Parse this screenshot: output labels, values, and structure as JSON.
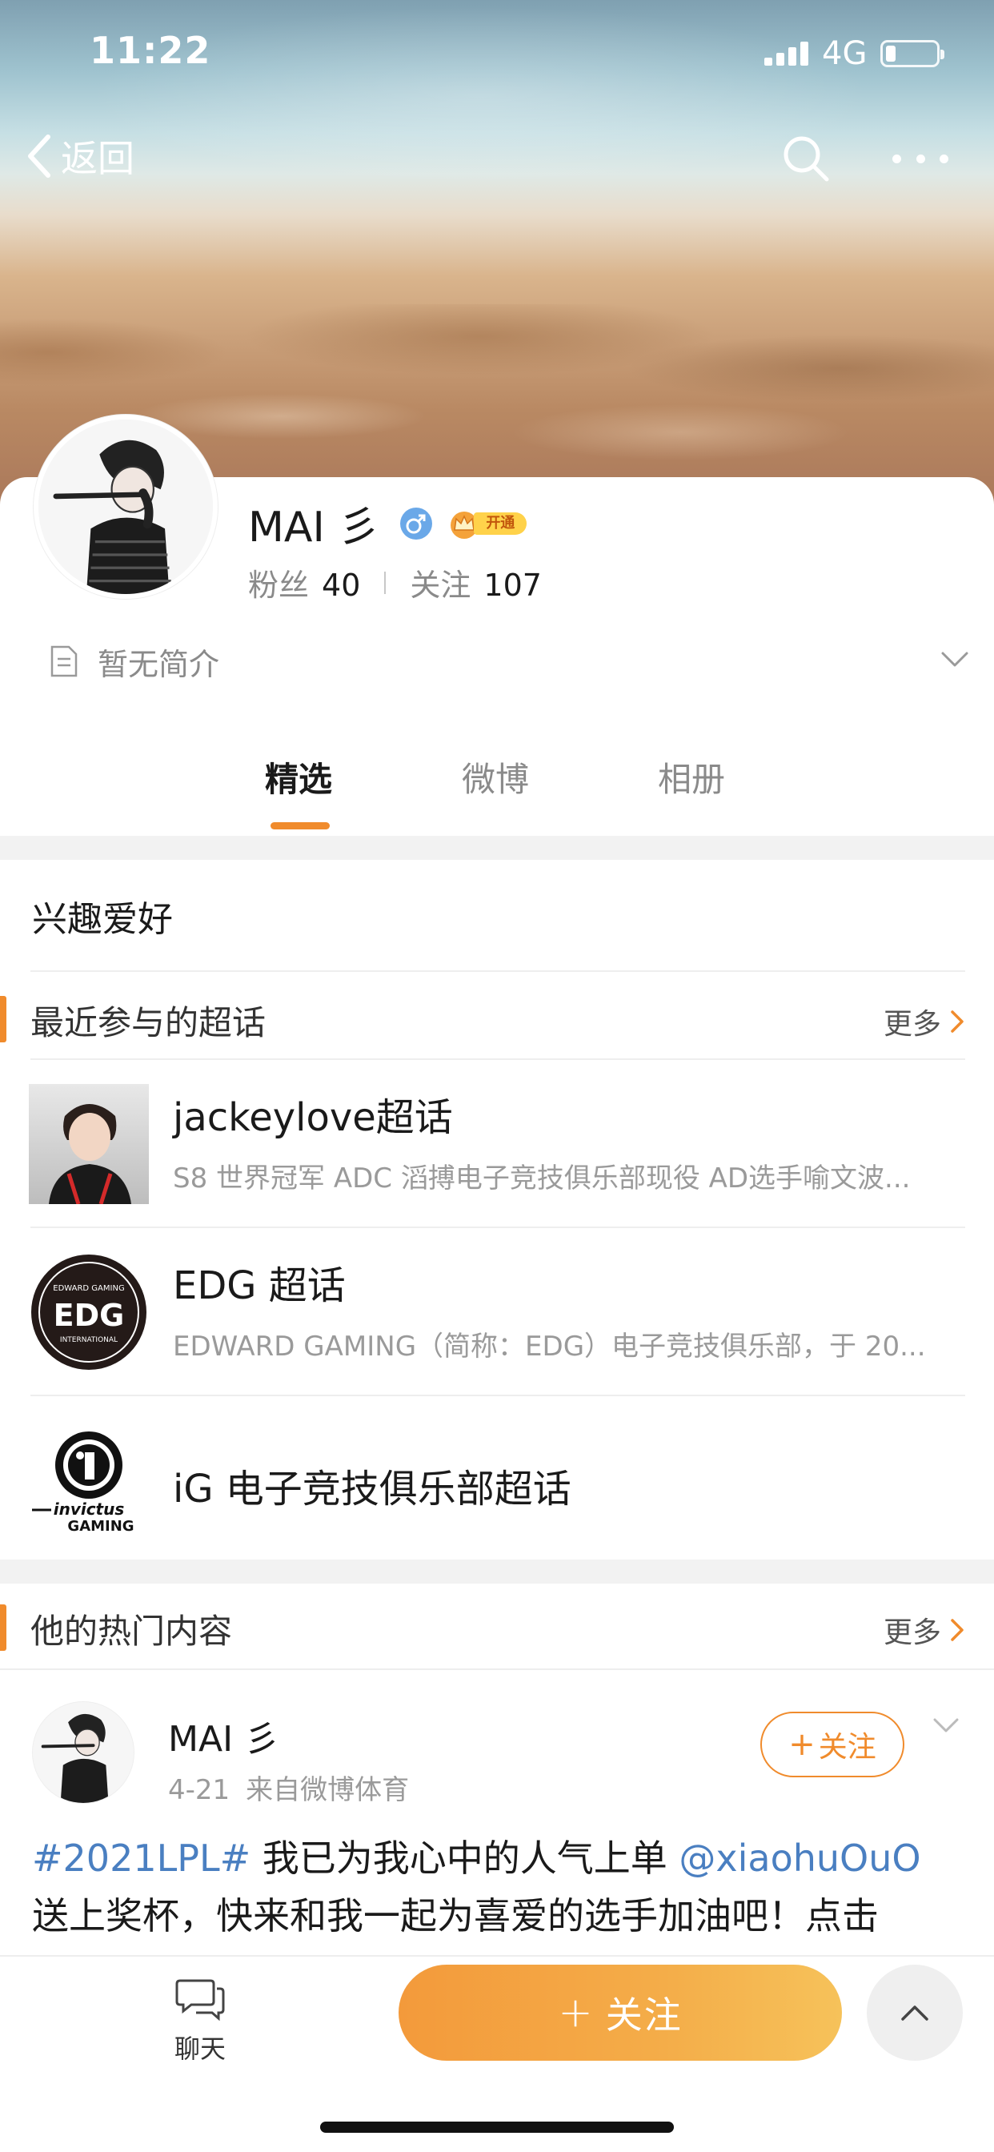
{
  "status_bar": {
    "time": "11:22",
    "network": "4G"
  },
  "nav": {
    "back_label": "返回"
  },
  "profile": {
    "name": "MAI 彡",
    "vip_label": "开通",
    "fans_label": "粉丝",
    "fans_count": "40",
    "following_label": "关注",
    "following_count": "107",
    "intro": "暂无简介"
  },
  "tabs": [
    {
      "label": "精选",
      "active": true
    },
    {
      "label": "微博",
      "active": false
    },
    {
      "label": "相册",
      "active": false
    }
  ],
  "interests": {
    "title": "兴趣爱好",
    "topics_header": "最近参与的超话",
    "more_label": "更多",
    "topics": [
      {
        "title": "jackeylove超话",
        "desc": "S8 世界冠军 ADC 滔搏电子竞技俱乐部现役 AD选手喻文波..."
      },
      {
        "title": "EDG 超话",
        "desc": "EDWARD GAMING（简称：EDG）电子竞技俱乐部，于 20..."
      },
      {
        "title": "iG 电子竞技俱乐部超话",
        "desc": ""
      }
    ],
    "edg_logo_top": "EDWARD GAMING",
    "edg_logo_main": "EDG",
    "edg_logo_bottom": "INTERNATIONAL",
    "ig_logo_text1": "invictus",
    "ig_logo_text2": "GAMING"
  },
  "hot_content": {
    "header": "他的热门内容",
    "more_label": "更多",
    "post": {
      "author": "MAI 彡",
      "date": "4-21",
      "source": "来自微博体育",
      "follow_label": "关注",
      "hashtag": "#2021LPL#",
      "text_part1": " 我已为我心中的人气上单 ",
      "mention": "@xiaohuOuO",
      "text_part2": "送上奖杯，快来和我一起为喜爱的选手加油吧！点击"
    }
  },
  "bottom_bar": {
    "chat_label": "聊天",
    "follow_label": "关注"
  },
  "colors": {
    "accent": "#f08b2c",
    "link": "#4a7fc1",
    "gender": "#6aa8e8"
  }
}
